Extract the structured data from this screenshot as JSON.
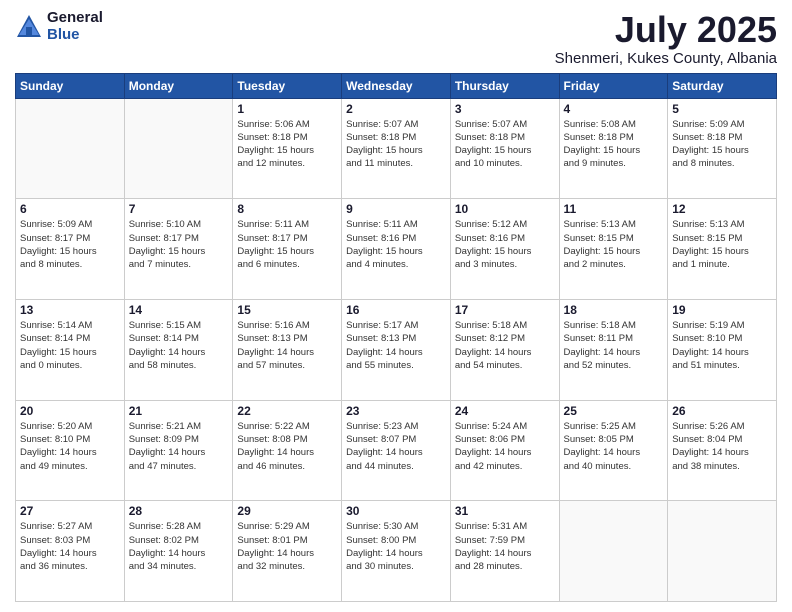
{
  "logo": {
    "general": "General",
    "blue": "Blue"
  },
  "title": "July 2025",
  "subtitle": "Shenmeri, Kukes County, Albania",
  "weekdays": [
    "Sunday",
    "Monday",
    "Tuesday",
    "Wednesday",
    "Thursday",
    "Friday",
    "Saturday"
  ],
  "weeks": [
    [
      {
        "day": "",
        "info": ""
      },
      {
        "day": "",
        "info": ""
      },
      {
        "day": "1",
        "info": "Sunrise: 5:06 AM\nSunset: 8:18 PM\nDaylight: 15 hours\nand 12 minutes."
      },
      {
        "day": "2",
        "info": "Sunrise: 5:07 AM\nSunset: 8:18 PM\nDaylight: 15 hours\nand 11 minutes."
      },
      {
        "day": "3",
        "info": "Sunrise: 5:07 AM\nSunset: 8:18 PM\nDaylight: 15 hours\nand 10 minutes."
      },
      {
        "day": "4",
        "info": "Sunrise: 5:08 AM\nSunset: 8:18 PM\nDaylight: 15 hours\nand 9 minutes."
      },
      {
        "day": "5",
        "info": "Sunrise: 5:09 AM\nSunset: 8:18 PM\nDaylight: 15 hours\nand 8 minutes."
      }
    ],
    [
      {
        "day": "6",
        "info": "Sunrise: 5:09 AM\nSunset: 8:17 PM\nDaylight: 15 hours\nand 8 minutes."
      },
      {
        "day": "7",
        "info": "Sunrise: 5:10 AM\nSunset: 8:17 PM\nDaylight: 15 hours\nand 7 minutes."
      },
      {
        "day": "8",
        "info": "Sunrise: 5:11 AM\nSunset: 8:17 PM\nDaylight: 15 hours\nand 6 minutes."
      },
      {
        "day": "9",
        "info": "Sunrise: 5:11 AM\nSunset: 8:16 PM\nDaylight: 15 hours\nand 4 minutes."
      },
      {
        "day": "10",
        "info": "Sunrise: 5:12 AM\nSunset: 8:16 PM\nDaylight: 15 hours\nand 3 minutes."
      },
      {
        "day": "11",
        "info": "Sunrise: 5:13 AM\nSunset: 8:15 PM\nDaylight: 15 hours\nand 2 minutes."
      },
      {
        "day": "12",
        "info": "Sunrise: 5:13 AM\nSunset: 8:15 PM\nDaylight: 15 hours\nand 1 minute."
      }
    ],
    [
      {
        "day": "13",
        "info": "Sunrise: 5:14 AM\nSunset: 8:14 PM\nDaylight: 15 hours\nand 0 minutes."
      },
      {
        "day": "14",
        "info": "Sunrise: 5:15 AM\nSunset: 8:14 PM\nDaylight: 14 hours\nand 58 minutes."
      },
      {
        "day": "15",
        "info": "Sunrise: 5:16 AM\nSunset: 8:13 PM\nDaylight: 14 hours\nand 57 minutes."
      },
      {
        "day": "16",
        "info": "Sunrise: 5:17 AM\nSunset: 8:13 PM\nDaylight: 14 hours\nand 55 minutes."
      },
      {
        "day": "17",
        "info": "Sunrise: 5:18 AM\nSunset: 8:12 PM\nDaylight: 14 hours\nand 54 minutes."
      },
      {
        "day": "18",
        "info": "Sunrise: 5:18 AM\nSunset: 8:11 PM\nDaylight: 14 hours\nand 52 minutes."
      },
      {
        "day": "19",
        "info": "Sunrise: 5:19 AM\nSunset: 8:10 PM\nDaylight: 14 hours\nand 51 minutes."
      }
    ],
    [
      {
        "day": "20",
        "info": "Sunrise: 5:20 AM\nSunset: 8:10 PM\nDaylight: 14 hours\nand 49 minutes."
      },
      {
        "day": "21",
        "info": "Sunrise: 5:21 AM\nSunset: 8:09 PM\nDaylight: 14 hours\nand 47 minutes."
      },
      {
        "day": "22",
        "info": "Sunrise: 5:22 AM\nSunset: 8:08 PM\nDaylight: 14 hours\nand 46 minutes."
      },
      {
        "day": "23",
        "info": "Sunrise: 5:23 AM\nSunset: 8:07 PM\nDaylight: 14 hours\nand 44 minutes."
      },
      {
        "day": "24",
        "info": "Sunrise: 5:24 AM\nSunset: 8:06 PM\nDaylight: 14 hours\nand 42 minutes."
      },
      {
        "day": "25",
        "info": "Sunrise: 5:25 AM\nSunset: 8:05 PM\nDaylight: 14 hours\nand 40 minutes."
      },
      {
        "day": "26",
        "info": "Sunrise: 5:26 AM\nSunset: 8:04 PM\nDaylight: 14 hours\nand 38 minutes."
      }
    ],
    [
      {
        "day": "27",
        "info": "Sunrise: 5:27 AM\nSunset: 8:03 PM\nDaylight: 14 hours\nand 36 minutes."
      },
      {
        "day": "28",
        "info": "Sunrise: 5:28 AM\nSunset: 8:02 PM\nDaylight: 14 hours\nand 34 minutes."
      },
      {
        "day": "29",
        "info": "Sunrise: 5:29 AM\nSunset: 8:01 PM\nDaylight: 14 hours\nand 32 minutes."
      },
      {
        "day": "30",
        "info": "Sunrise: 5:30 AM\nSunset: 8:00 PM\nDaylight: 14 hours\nand 30 minutes."
      },
      {
        "day": "31",
        "info": "Sunrise: 5:31 AM\nSunset: 7:59 PM\nDaylight: 14 hours\nand 28 minutes."
      },
      {
        "day": "",
        "info": ""
      },
      {
        "day": "",
        "info": ""
      }
    ]
  ]
}
